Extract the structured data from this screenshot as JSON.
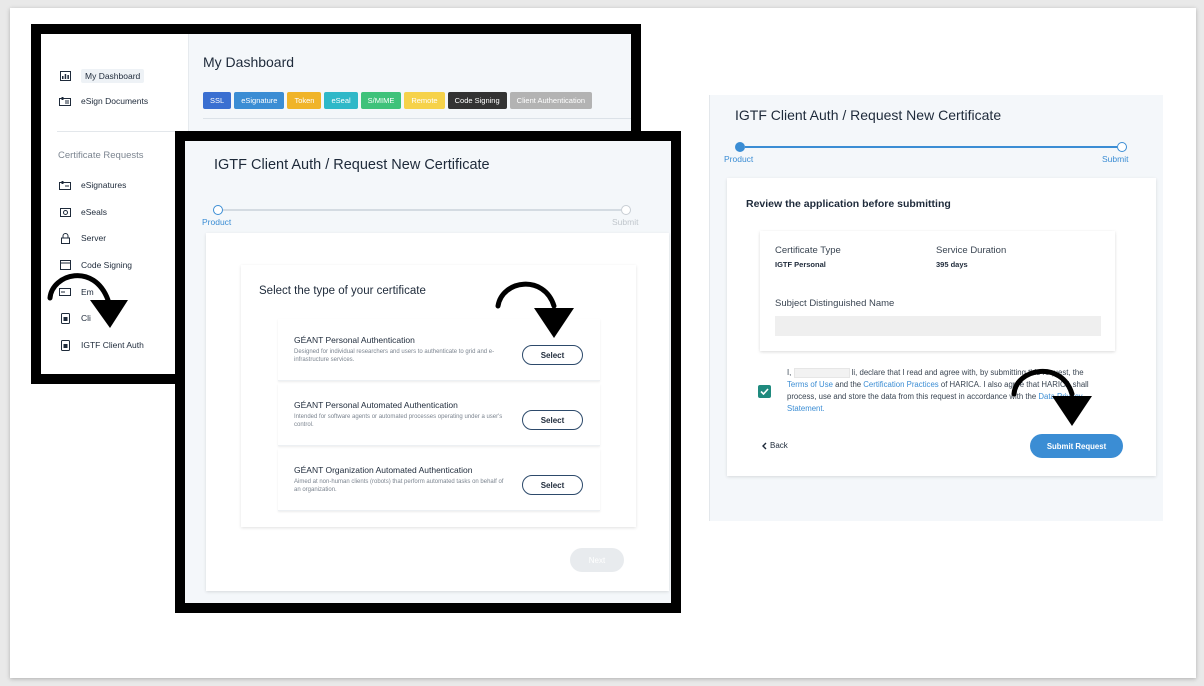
{
  "dashboard": {
    "title": "My Dashboard",
    "nav_top": [
      {
        "label": "My Dashboard",
        "icon": "dashboard-icon"
      },
      {
        "label": "eSign Documents",
        "icon": "document-icon"
      }
    ],
    "section_heading": "Certificate Requests",
    "nav_requests": [
      {
        "label": "eSignatures",
        "icon": "signature-icon"
      },
      {
        "label": "eSeals",
        "icon": "seal-icon"
      },
      {
        "label": "Server",
        "icon": "lock-icon"
      },
      {
        "label": "Code Signing",
        "icon": "code-icon"
      },
      {
        "label": "Em",
        "icon": "email-icon"
      },
      {
        "label": "Cli",
        "icon": "client-icon"
      },
      {
        "label": "IGTF Client Auth",
        "icon": "client-icon"
      }
    ],
    "tags": [
      {
        "label": "SSL",
        "color": "#3a6fd1"
      },
      {
        "label": "eSignature",
        "color": "#3b8dd4"
      },
      {
        "label": "Token",
        "color": "#f0b429"
      },
      {
        "label": "eSeal",
        "color": "#2fb8c8"
      },
      {
        "label": "S/MIME",
        "color": "#3ec27a"
      },
      {
        "label": "Remote",
        "color": "#f6d24a"
      },
      {
        "label": "Code Signing",
        "color": "#333333"
      },
      {
        "label": "Client Authentication",
        "color": "#b3b3b3"
      }
    ]
  },
  "select_panel": {
    "title": "IGTF Client Auth / Request New Certificate",
    "steps": [
      "Product",
      "Submit"
    ],
    "card_title": "Select the type of your certificate",
    "options": [
      {
        "title": "GÉANT Personal Authentication",
        "description": "Designed for individual researchers and users to authenticate to grid and e-infrastructure services.",
        "button": "Select"
      },
      {
        "title": "GÉANT Personal Automated Authentication",
        "description": "Intended for software agents or automated processes operating under a user's control.",
        "button": "Select"
      },
      {
        "title": "GÉANT Organization Automated Authentication",
        "description": "Aimed at non-human clients (robots) that perform automated tasks on behalf of an organization.",
        "button": "Select"
      }
    ],
    "next_button": "Next"
  },
  "review_panel": {
    "title": "IGTF Client Auth / Request New Certificate",
    "steps": [
      "Product",
      "Submit"
    ],
    "card_title": "Review the application before submitting",
    "certificate_type_label": "Certificate Type",
    "certificate_type_value": "IGTF Personal",
    "service_duration_label": "Service Duration",
    "service_duration_value": "395 days",
    "subject_dn_label": "Subject Distinguished Name",
    "agreement": {
      "prefix": "I,",
      "name_suffix": "li",
      "part1": ", declare that I read and agree with, by submitting this request, the",
      "terms_link": "Terms of Use",
      "part2": " and the ",
      "practices_link": "Certification Practices",
      "part3": " of HARICA. I also agree that HARICA shall process, use and store the data from this request in accordance with the ",
      "privacy_link": "Data Privacy Statement",
      "end": "."
    },
    "back_button": "Back",
    "submit_button": "Submit Request"
  }
}
